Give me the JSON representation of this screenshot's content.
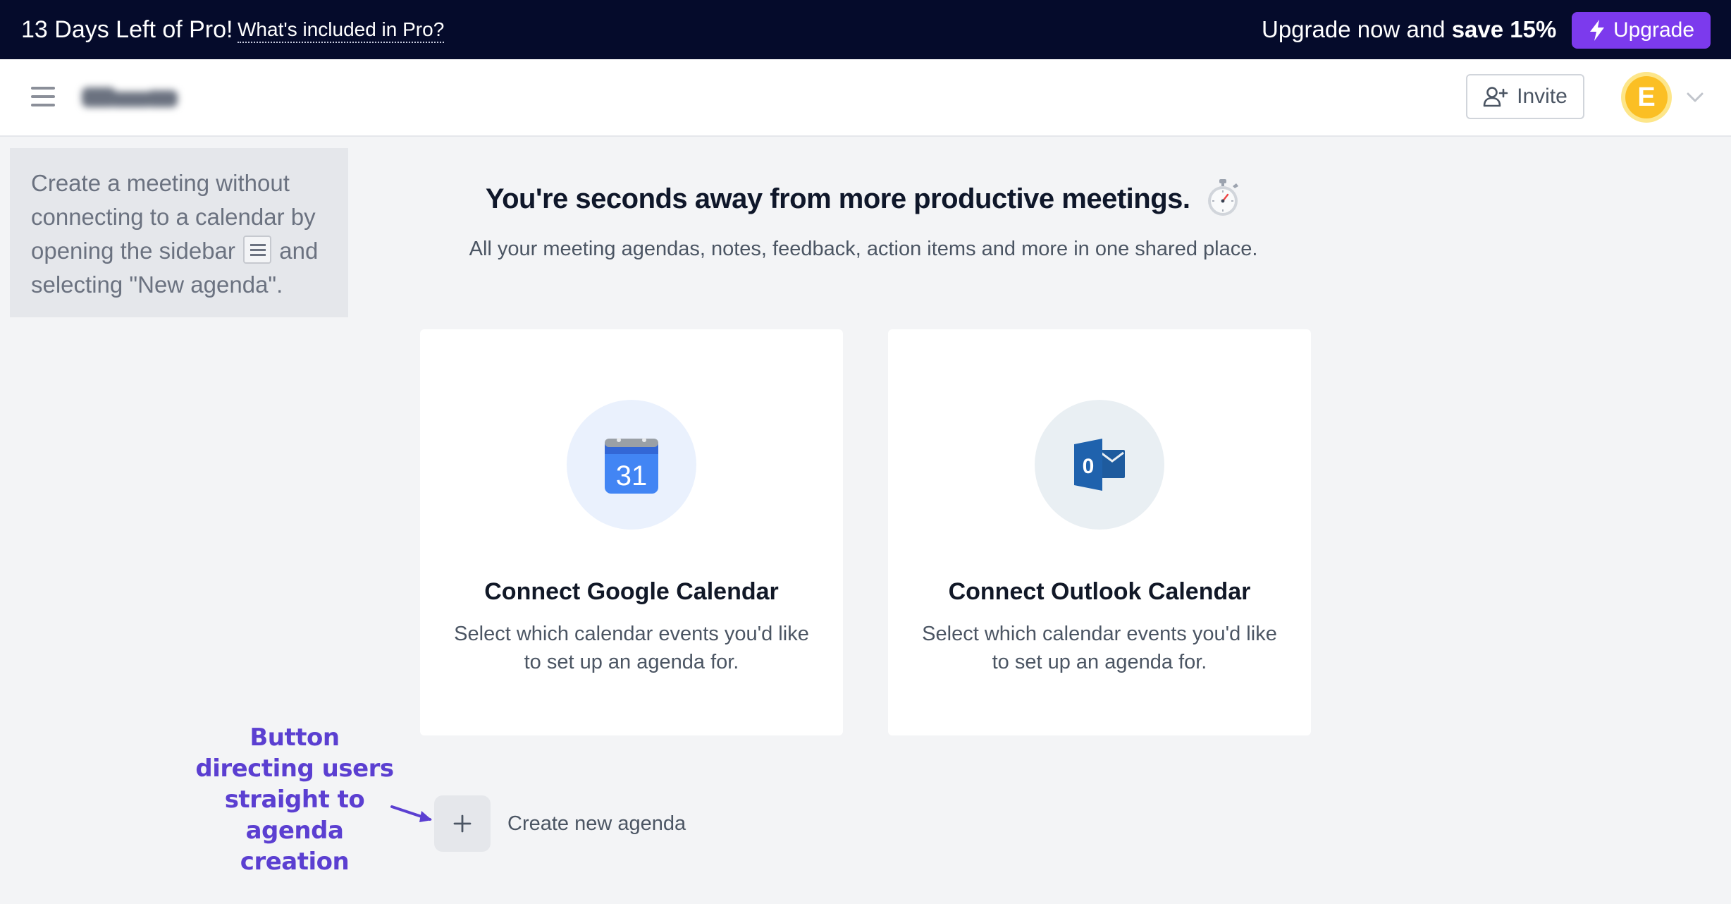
{
  "promo": {
    "days_left": "13 Days Left of Pro!",
    "whats_included_link": "What's included in Pro?",
    "cta_prefix": "Upgrade now and ",
    "cta_bold": "save 15%",
    "upgrade_button": "Upgrade",
    "upgrade_icon": "lightning-icon"
  },
  "header": {
    "menu_icon": "hamburger-menu-icon",
    "invite_button": "Invite",
    "invite_icon": "user-plus-icon",
    "avatar_initial": "E",
    "avatar_chevron_icon": "chevron-down-icon"
  },
  "hint": {
    "text_before_icon": "Create a meeting without connecting to a calendar by opening the sidebar",
    "inline_icon": "hamburger-menu-icon",
    "text_after_icon": "and selecting \"New agenda\"."
  },
  "hero": {
    "title": "You're seconds away from more productive meetings.",
    "title_icon": "stopwatch-icon",
    "subtitle": "All your meeting agendas, notes, feedback, action items and more in one shared place."
  },
  "cards": [
    {
      "icon": "google-calendar-icon",
      "icon_text": "31",
      "title": "Connect Google Calendar",
      "description": "Select which calendar events you'd like to set up an agenda for."
    },
    {
      "icon": "outlook-icon",
      "icon_text": "0",
      "title": "Connect Outlook Calendar",
      "description": "Select which calendar events you'd like to set up an agenda for."
    }
  ],
  "annotation": {
    "text": "Button directing users straight to agenda creation",
    "arrow_icon": "arrow-right-icon"
  },
  "create_agenda": {
    "icon": "plus-icon",
    "label": "Create new agenda"
  },
  "colors": {
    "promo_bg": "#050b2b",
    "upgrade_purple": "#7c3aed",
    "annotation_purple": "#5b3fd1",
    "avatar_yellow": "#fbbf24",
    "page_bg": "#f3f4f6"
  }
}
